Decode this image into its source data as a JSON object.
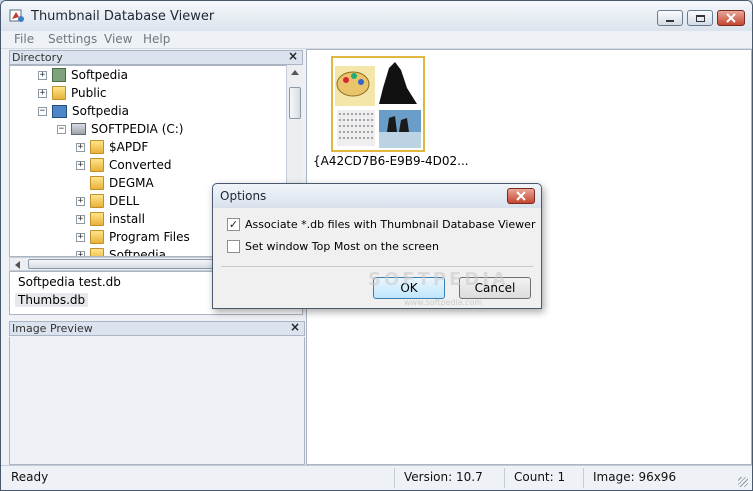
{
  "window": {
    "title": "Thumbnail Database Viewer"
  },
  "menu": [
    "File",
    "Settings",
    "View",
    "Help"
  ],
  "directory_panel": {
    "title": "Directory",
    "tree": [
      {
        "label": "Softpedia",
        "level": 1,
        "expander": "+",
        "icon": "drive-icon"
      },
      {
        "label": "Public",
        "level": 1,
        "expander": "+",
        "icon": "folder-icon"
      },
      {
        "label": "Softpedia",
        "level": 1,
        "expander": "-",
        "icon": "computer-icon"
      },
      {
        "label": "SOFTPEDIA (C:)",
        "level": 2,
        "expander": "-",
        "icon": "drive-icon"
      },
      {
        "label": "$APDF",
        "level": 3,
        "expander": "+",
        "icon": "folder-icon"
      },
      {
        "label": "Converted",
        "level": 3,
        "expander": "+",
        "icon": "folder-icon"
      },
      {
        "label": "DEGMA",
        "level": 3,
        "expander": "",
        "icon": "folder-icon"
      },
      {
        "label": "DELL",
        "level": 3,
        "expander": "+",
        "icon": "folder-icon"
      },
      {
        "label": "install",
        "level": 3,
        "expander": "+",
        "icon": "folder-icon"
      },
      {
        "label": "Program Files",
        "level": 3,
        "expander": "+",
        "icon": "folder-icon"
      },
      {
        "label": "Softpedia",
        "level": 3,
        "expander": "+",
        "icon": "folder-icon"
      }
    ],
    "files": [
      "Softpedia test.db",
      "Thumbs.db"
    ]
  },
  "preview_panel": {
    "title": "Image Preview"
  },
  "main": {
    "thumbnail_caption": "{A42CD7B6-E9B9-4D02..."
  },
  "dialog": {
    "title": "Options",
    "options": [
      {
        "label": "Associate *.db files with Thumbnail Database Viewer",
        "checked": true
      },
      {
        "label": "Set window Top Most on the screen",
        "checked": false
      }
    ],
    "ok_label": "OK",
    "cancel_label": "Cancel"
  },
  "status": {
    "state": "Ready",
    "version": "Version: 10.7",
    "count": "Count: 1",
    "image": "Image: 96x96"
  },
  "watermark": {
    "main": "SOFTPEDIA",
    "sub": "www.softpedia.com"
  },
  "colors": {
    "accent": "#3c7fb1",
    "close_red": "#c5452f",
    "folder": "#e8b23a"
  }
}
